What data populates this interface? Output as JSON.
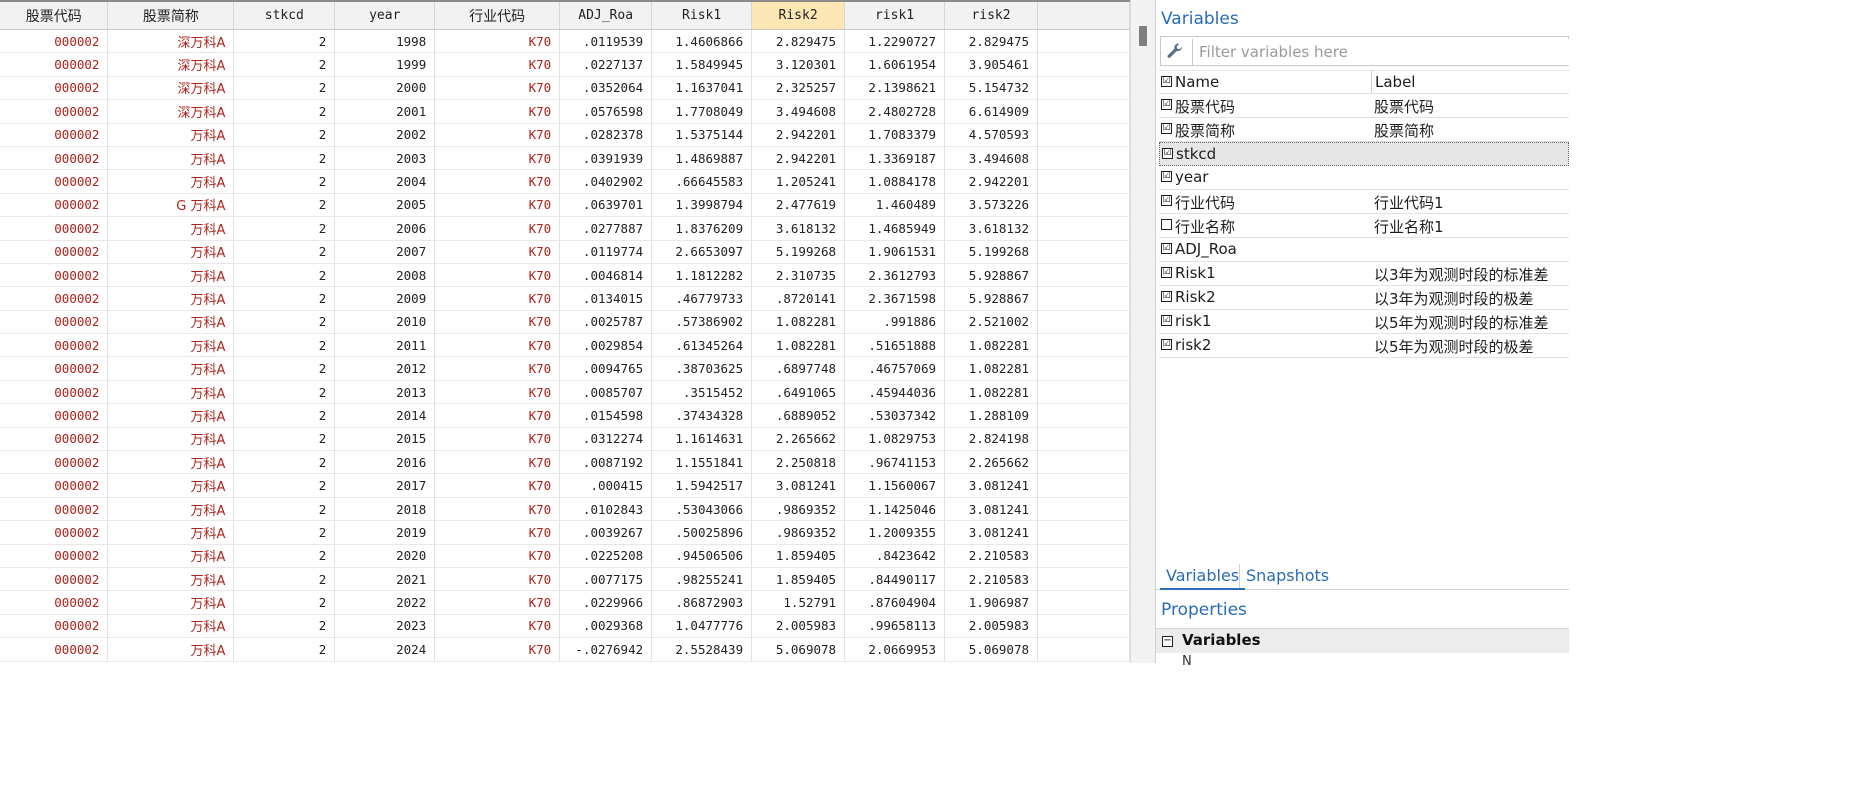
{
  "grid": {
    "columns": [
      {
        "label": "股票代码",
        "cjk": true
      },
      {
        "label": "股票简称",
        "cjk": true
      },
      {
        "label": "stkcd",
        "cjk": false
      },
      {
        "label": "year",
        "cjk": false
      },
      {
        "label": "行业代码",
        "cjk": true
      },
      {
        "label": "ADJ_Roa",
        "cjk": false
      },
      {
        "label": "Risk1",
        "cjk": false
      },
      {
        "label": "Risk2",
        "cjk": false,
        "selected": true
      },
      {
        "label": "risk1",
        "cjk": false
      },
      {
        "label": "risk2",
        "cjk": false
      }
    ],
    "rows": [
      [
        "000002",
        "深万科A",
        "2",
        "1998",
        "K70",
        ".0119539",
        "1.4606866",
        "2.829475",
        "1.2290727",
        "2.829475"
      ],
      [
        "000002",
        "深万科A",
        "2",
        "1999",
        "K70",
        ".0227137",
        "1.5849945",
        "3.120301",
        "1.6061954",
        "3.905461"
      ],
      [
        "000002",
        "深万科A",
        "2",
        "2000",
        "K70",
        ".0352064",
        "1.1637041",
        "2.325257",
        "2.1398621",
        "5.154732"
      ],
      [
        "000002",
        "深万科A",
        "2",
        "2001",
        "K70",
        ".0576598",
        "1.7708049",
        "3.494608",
        "2.4802728",
        "6.614909"
      ],
      [
        "000002",
        "万科A",
        "2",
        "2002",
        "K70",
        ".0282378",
        "1.5375144",
        "2.942201",
        "1.7083379",
        "4.570593"
      ],
      [
        "000002",
        "万科A",
        "2",
        "2003",
        "K70",
        ".0391939",
        "1.4869887",
        "2.942201",
        "1.3369187",
        "3.494608"
      ],
      [
        "000002",
        "万科A",
        "2",
        "2004",
        "K70",
        ".0402902",
        ".66645583",
        "1.205241",
        "1.0884178",
        "2.942201"
      ],
      [
        "000002",
        "G 万科A",
        "2",
        "2005",
        "K70",
        ".0639701",
        "1.3998794",
        "2.477619",
        "1.460489",
        "3.573226"
      ],
      [
        "000002",
        "万科A",
        "2",
        "2006",
        "K70",
        ".0277887",
        "1.8376209",
        "3.618132",
        "1.4685949",
        "3.618132"
      ],
      [
        "000002",
        "万科A",
        "2",
        "2007",
        "K70",
        ".0119774",
        "2.6653097",
        "5.199268",
        "1.9061531",
        "5.199268"
      ],
      [
        "000002",
        "万科A",
        "2",
        "2008",
        "K70",
        ".0046814",
        "1.1812282",
        "2.310735",
        "2.3612793",
        "5.928867"
      ],
      [
        "000002",
        "万科A",
        "2",
        "2009",
        "K70",
        ".0134015",
        ".46779733",
        ".8720141",
        "2.3671598",
        "5.928867"
      ],
      [
        "000002",
        "万科A",
        "2",
        "2010",
        "K70",
        ".0025787",
        ".57386902",
        "1.082281",
        ".991886",
        "2.521002"
      ],
      [
        "000002",
        "万科A",
        "2",
        "2011",
        "K70",
        ".0029854",
        ".61345264",
        "1.082281",
        ".51651888",
        "1.082281"
      ],
      [
        "000002",
        "万科A",
        "2",
        "2012",
        "K70",
        ".0094765",
        ".38703625",
        ".6897748",
        ".46757069",
        "1.082281"
      ],
      [
        "000002",
        "万科A",
        "2",
        "2013",
        "K70",
        ".0085707",
        ".3515452",
        ".6491065",
        ".45944036",
        "1.082281"
      ],
      [
        "000002",
        "万科A",
        "2",
        "2014",
        "K70",
        ".0154598",
        ".37434328",
        ".6889052",
        ".53037342",
        "1.288109"
      ],
      [
        "000002",
        "万科A",
        "2",
        "2015",
        "K70",
        ".0312274",
        "1.1614631",
        "2.265662",
        "1.0829753",
        "2.824198"
      ],
      [
        "000002",
        "万科A",
        "2",
        "2016",
        "K70",
        ".0087192",
        "1.1551841",
        "2.250818",
        ".96741153",
        "2.265662"
      ],
      [
        "000002",
        "万科A",
        "2",
        "2017",
        "K70",
        ".000415",
        "1.5942517",
        "3.081241",
        "1.1560067",
        "3.081241"
      ],
      [
        "000002",
        "万科A",
        "2",
        "2018",
        "K70",
        ".0102843",
        ".53043066",
        ".9869352",
        "1.1425046",
        "3.081241"
      ],
      [
        "000002",
        "万科A",
        "2",
        "2019",
        "K70",
        ".0039267",
        ".50025896",
        ".9869352",
        "1.2009355",
        "3.081241"
      ],
      [
        "000002",
        "万科A",
        "2",
        "2020",
        "K70",
        ".0225208",
        ".94506506",
        "1.859405",
        ".8423642",
        "2.210583"
      ],
      [
        "000002",
        "万科A",
        "2",
        "2021",
        "K70",
        ".0077175",
        ".98255241",
        "1.859405",
        ".84490117",
        "2.210583"
      ],
      [
        "000002",
        "万科A",
        "2",
        "2022",
        "K70",
        ".0229966",
        ".86872903",
        "1.52791",
        ".87604904",
        "1.906987"
      ],
      [
        "000002",
        "万科A",
        "2",
        "2023",
        "K70",
        ".0029368",
        "1.0477776",
        "2.005983",
        ".99658113",
        "2.005983"
      ],
      [
        "000002",
        "万科A",
        "2",
        "2024",
        "K70",
        "-.0276942",
        "2.5528439",
        "5.069078",
        "2.0669953",
        "5.069078"
      ]
    ],
    "string_columns": [
      0,
      1,
      4
    ]
  },
  "variables_panel": {
    "title": "Variables",
    "filter_placeholder": "Filter variables here",
    "header": {
      "name": "Name",
      "label": "Label"
    },
    "items": [
      {
        "name": "股票代码",
        "label": "股票代码",
        "checked": true
      },
      {
        "name": "股票简称",
        "label": "股票简称",
        "checked": true
      },
      {
        "name": "stkcd",
        "label": "",
        "checked": true,
        "selected": true
      },
      {
        "name": "year",
        "label": "",
        "checked": true
      },
      {
        "name": "行业代码",
        "label": "行业代码1",
        "checked": true
      },
      {
        "name": "行业名称",
        "label": "行业名称1",
        "checked": false
      },
      {
        "name": "ADJ_Roa",
        "label": "",
        "checked": true
      },
      {
        "name": "Risk1",
        "label": "以3年为观测时段的标准差",
        "checked": true
      },
      {
        "name": "Risk2",
        "label": "以3年为观测时段的极差",
        "checked": true
      },
      {
        "name": "risk1",
        "label": "以5年为观测时段的标准差",
        "checked": true
      },
      {
        "name": "risk2",
        "label": "以5年为观测时段的极差",
        "checked": true
      }
    ],
    "tabs": [
      "Variables",
      "Snapshots"
    ]
  },
  "properties_panel": {
    "title": "Properties",
    "group_label": "Variables",
    "partial_row": "N"
  },
  "colors": {
    "accent": "#2a6cb8",
    "string_value": "#b0221b",
    "selected_header": "#fbe6b4"
  }
}
